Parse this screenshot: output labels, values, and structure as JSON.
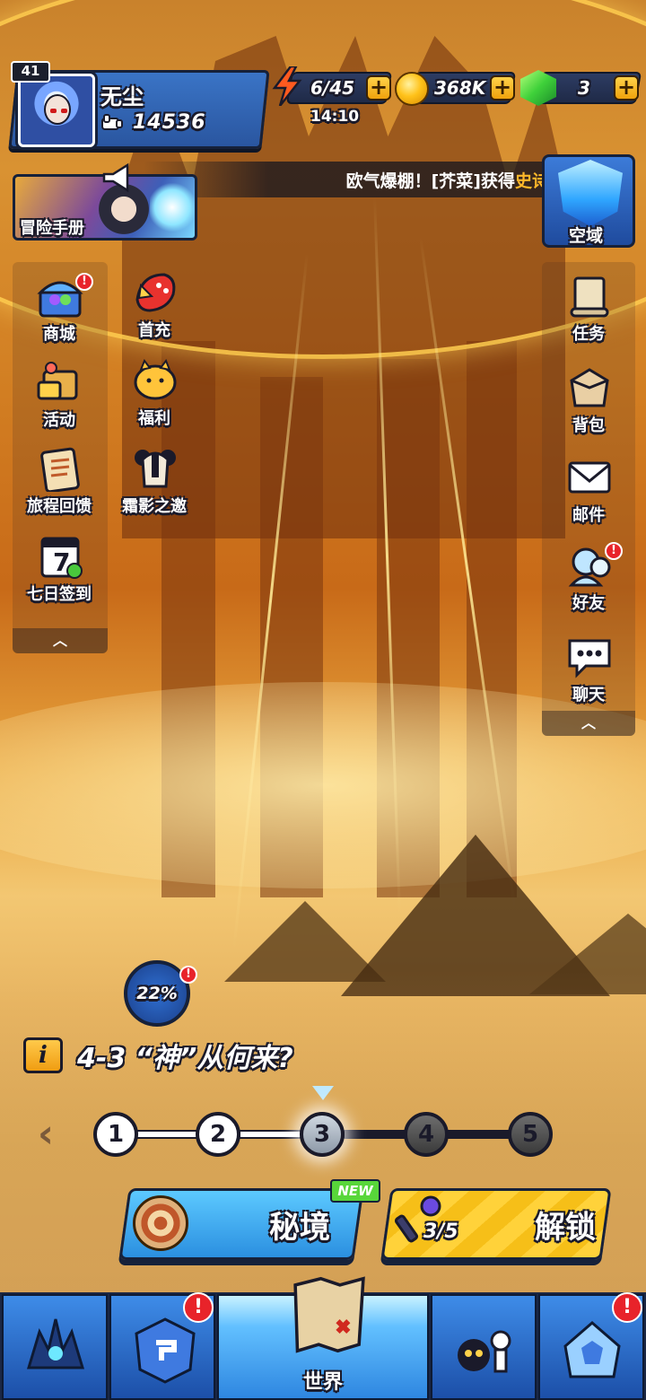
{
  "player": {
    "level": "41",
    "name": "无尘",
    "power": "14536"
  },
  "resources": {
    "energy": "6/45",
    "energy_timer": "14:10",
    "coins": "368K",
    "gems": "3",
    "plus": "+"
  },
  "marquee": {
    "text": "欧气爆棚！[芥菜]获得",
    "highlight": "史诗"
  },
  "handbook": {
    "label": "冒险手册"
  },
  "sky_domain": {
    "label": "空域"
  },
  "left_menu": {
    "items": [
      {
        "label": "商城",
        "icon": "treasure-chest-icon",
        "alert": "!"
      },
      {
        "label": "首充",
        "icon": "first-recharge-icon"
      },
      {
        "label": "活动",
        "icon": "event-icon"
      },
      {
        "label": "福利",
        "icon": "piggy-bank-icon"
      },
      {
        "label": "旅程回馈",
        "icon": "clipboard-icon"
      },
      {
        "label": "霜影之邀",
        "icon": "frost-shadow-icon"
      },
      {
        "label": "七日签到",
        "icon": "calendar-icon",
        "calendar_day": "7"
      }
    ],
    "collapse": "︿"
  },
  "right_menu": {
    "items": [
      {
        "label": "任务",
        "icon": "scroll-icon"
      },
      {
        "label": "背包",
        "icon": "backpack-icon"
      },
      {
        "label": "邮件",
        "icon": "mail-icon"
      },
      {
        "label": "好友",
        "icon": "friends-icon",
        "alert": "!"
      },
      {
        "label": "聊天",
        "icon": "chat-icon"
      }
    ],
    "collapse": "︿"
  },
  "progress": {
    "percent": "22%",
    "alert": "!"
  },
  "stage": {
    "info": "i",
    "title": "4-3 “神”从何来?",
    "prev_arrow": "‹",
    "nodes": [
      "1",
      "2",
      "3",
      "4",
      "5"
    ],
    "current_index": 3
  },
  "actions": {
    "secret_realm": {
      "label": "秘境",
      "badge": "NEW"
    },
    "unlock": {
      "label": "解锁",
      "keys": "3/5"
    }
  },
  "bottom_nav": {
    "world_label": "世界",
    "alert": "!"
  },
  "colors": {
    "accent_blue": "#2b8fe0",
    "accent_yellow": "#ffd23a",
    "alert_red": "#e8232a",
    "new_green": "#58d63a"
  }
}
